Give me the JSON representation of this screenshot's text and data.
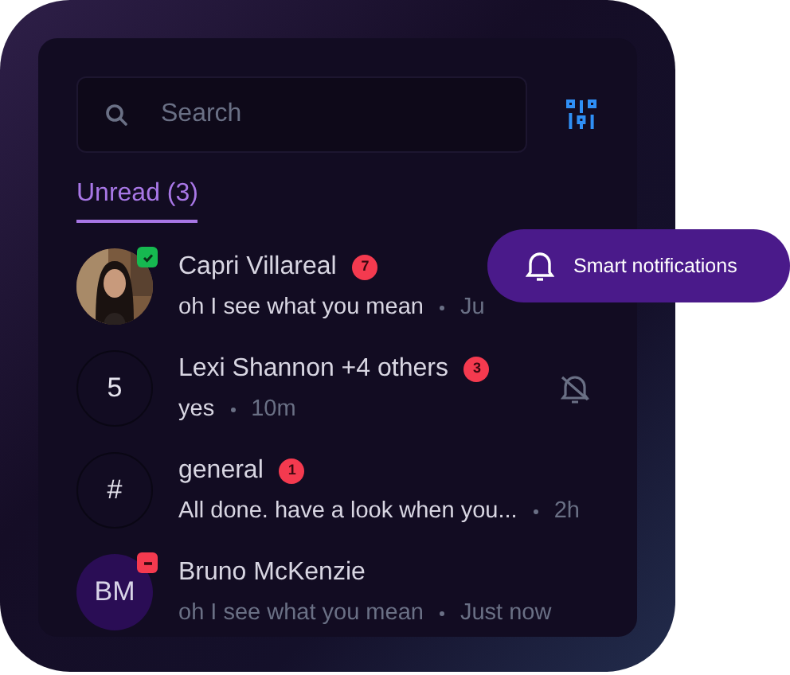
{
  "search": {
    "placeholder": "Search"
  },
  "tabs": [
    {
      "label": "Unread (3)",
      "selected": true
    }
  ],
  "conversations": [
    {
      "badge": {
        "kind": "online"
      },
      "name": "Capri Villareal",
      "unread": "7",
      "preview": "oh I see what you mean",
      "time": "Ju",
      "muted": false,
      "read": false
    },
    {
      "avatar": {
        "kind": "count",
        "text": "5"
      },
      "name": "Lexi Shannon +4 others",
      "unread": "3",
      "preview": "yes",
      "time": "10m",
      "muted": true,
      "read": false
    },
    {
      "avatar": {
        "kind": "channel",
        "text": "#"
      },
      "name": "general",
      "unread": "1",
      "preview": "All done. have a look when you...",
      "time": "2h",
      "muted": false,
      "read": false
    },
    {
      "avatar": {
        "kind": "initials",
        "text": "BM"
      },
      "badge": {
        "kind": "busy"
      },
      "name": "Bruno McKenzie",
      "preview": "oh I see what you mean",
      "time": "Just now",
      "muted": false,
      "read": true
    }
  ],
  "popup": {
    "label": "Smart notifications"
  }
}
